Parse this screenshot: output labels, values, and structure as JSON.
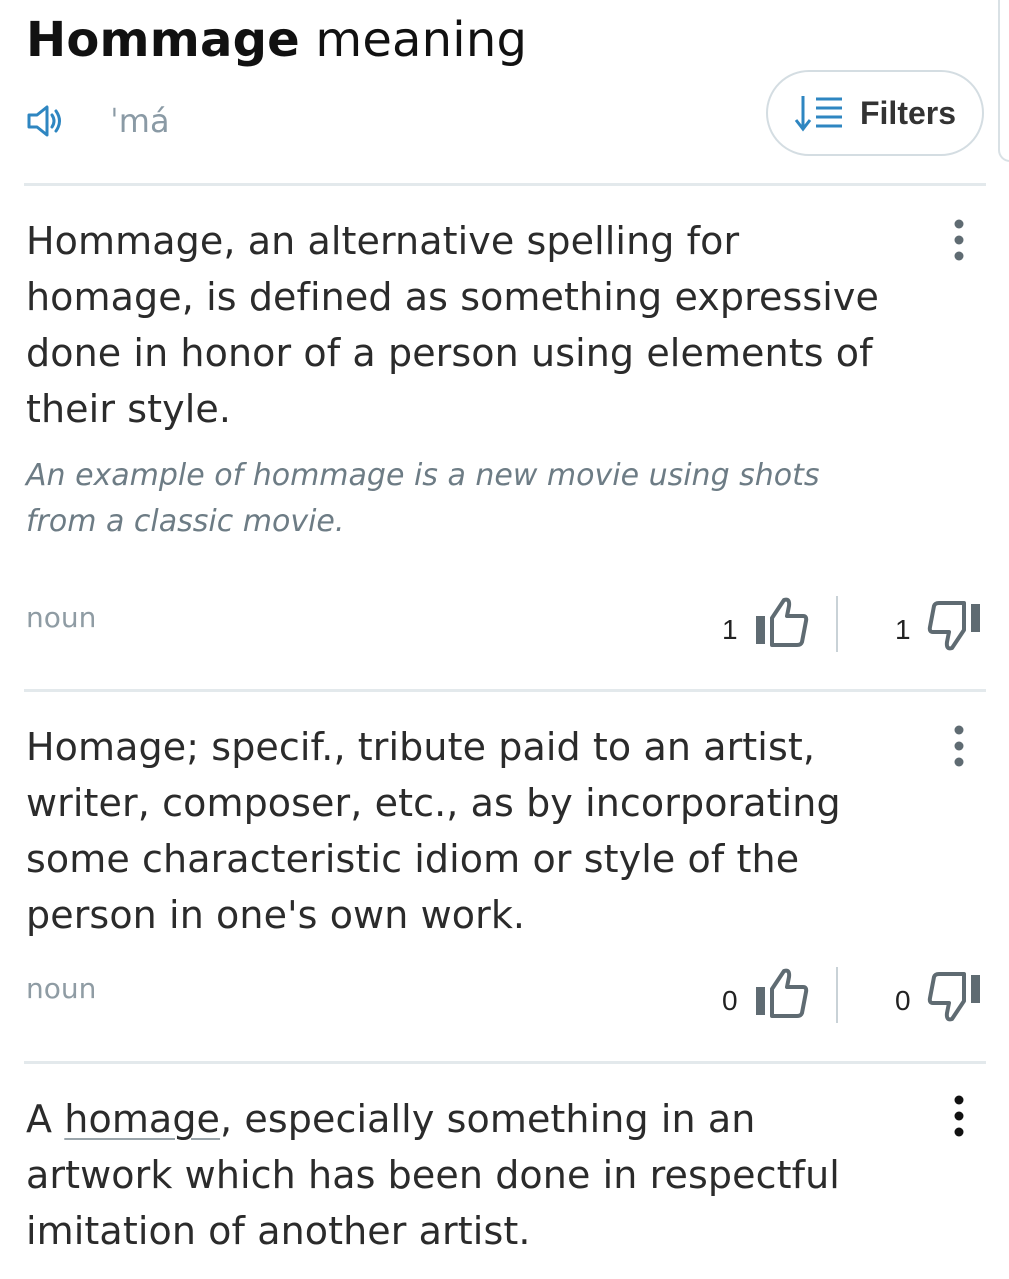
{
  "header": {
    "title_bold": "Hommage",
    "title_rest": "meaning",
    "pronunciation": "ˈmá",
    "filters_label": "Filters"
  },
  "entries": [
    {
      "definition": "Hommage, an alternative spelling for homage, is defined as something expressive done in honor of a person using elements of their style.",
      "example": "An example of hommage is a new movie using shots from a classic movie.",
      "part_of_speech": "noun",
      "upvotes": "1",
      "downvotes": "1"
    },
    {
      "definition": "Homage; specif., tribute paid to an artist, writer, composer, etc., as by incorporating some characteristic idiom or style of the person in one's own work.",
      "part_of_speech": "noun",
      "upvotes": "0",
      "downvotes": "0"
    },
    {
      "definition_prefix": "A ",
      "definition_link": "homage",
      "definition_suffix": ", especially something in an artwork which has been done in respectful imitation of another artist."
    }
  ],
  "colors": {
    "accent_blue": "#2e86c1",
    "icon_gray": "#5f6b72",
    "muted_text": "#8f9ca4"
  },
  "icons": [
    "speaker-icon",
    "sort-filter-icon",
    "more-vertical-icon",
    "thumbs-up-icon",
    "thumbs-down-icon"
  ]
}
